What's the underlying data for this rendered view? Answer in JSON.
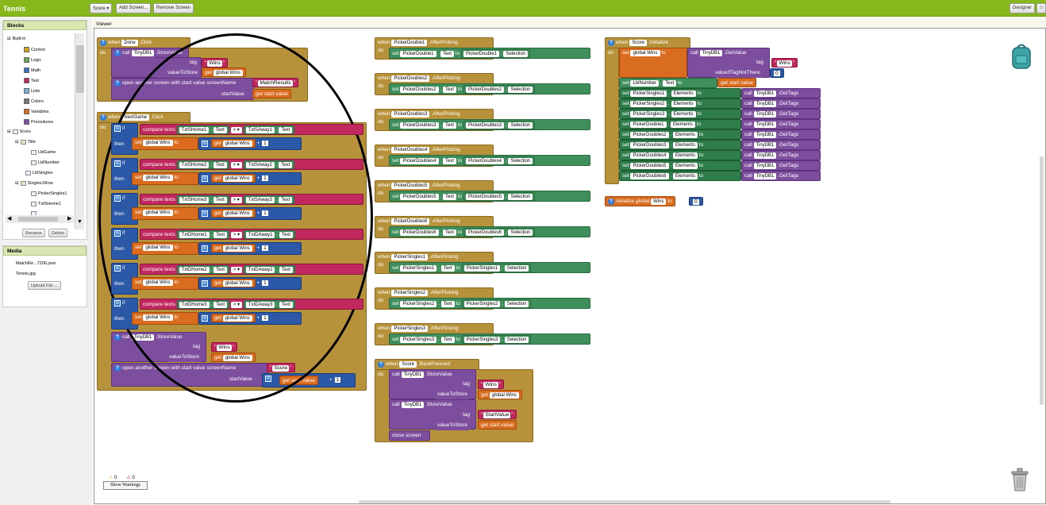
{
  "app": {
    "project_title": "Tennis",
    "screen_selector": "Score ▾",
    "add_screen": "Add Screen...",
    "remove_screen": "Remove Screen",
    "designer": "Designer",
    "blocks": "Bl"
  },
  "sidebar": {
    "blocks_title": "Blocks",
    "builtin": "Built-in",
    "builtin_items": [
      {
        "label": "Control",
        "color": "#d8a51e"
      },
      {
        "label": "Logic",
        "color": "#6aa84f"
      },
      {
        "label": "Math",
        "color": "#3d73c4"
      },
      {
        "label": "Text",
        "color": "#c0285e"
      },
      {
        "label": "Lists",
        "color": "#72b1d4"
      },
      {
        "label": "Colors",
        "color": "#777777"
      },
      {
        "label": "Variables",
        "color": "#d96c1e"
      },
      {
        "label": "Procedures",
        "color": "#7e4e9e"
      }
    ],
    "score": "Score",
    "title": "Title",
    "lbl_game": "LblGame",
    "lbl_number": "LblNumber",
    "lbl_singles": "LblSingles",
    "singles1_row": "Singles1Row",
    "picker_singles1": "PickerSingles1",
    "txt_shome1": "TxtSHome1",
    "rename": "Rename",
    "delete": "Delete",
    "media_title": "Media",
    "media_files": [
      "MatchRe...7206.json",
      "Tennis.jpg"
    ],
    "upload": "Upload File ..."
  },
  "viewer": {
    "title": "Viewer",
    "warnings": "0",
    "errors": "0",
    "show_warnings": "Show Warnings"
  },
  "kw": {
    "when": "when",
    "do": "do",
    "call": "call",
    "set": "set",
    "get": "get",
    "to": "to",
    "if": "if",
    "then": "then",
    "tag": "tag",
    "value_to_store": "valueToStore",
    "store_value": ".StoreValue",
    "click": ".Click",
    "after_picking": ".AfterPicking",
    "text": "Text",
    "selection": "Selection",
    "compare_texts": "compare texts",
    "gt": "> ▾",
    "plus": "+",
    "one": "1",
    "zero": "0",
    "open_another": "open another screen with start value",
    "screen_name": "screenName",
    "start_value": "startValue",
    "get_start_value": "get start value",
    "elements": "Elements",
    "get_tags": ".GetTags",
    "get_value": ".GetValue",
    "value_if_tag_not_there": "valueIfTagNotThere",
    "initialize": ".Initialize",
    "back_pressed": ".BackPressed",
    "close_screen": "close screen",
    "init_global": "initialize global",
    "wins": "Wins",
    "global_wins": "global Wins",
    "tinydb1": "TinyDB1",
    "match_results": "MatchResults",
    "score": "Score",
    "start_value_str": "StartValue",
    "done": "Done",
    "next_game": "NextGame",
    "lbl_number": "LblNumber"
  },
  "pickers": [
    {
      "picker": "PickerDouble1",
      "label": "PickerDouble1"
    },
    {
      "picker": "PickerDoubles2",
      "label": "PickerDoubles2"
    },
    {
      "picker": "PickerDoubles3",
      "label": "PickerDoubles3"
    },
    {
      "picker": "PickerDoubles4",
      "label": "PickerDoubles4"
    },
    {
      "picker": "PickerDoubles5",
      "label": "PickerDoubles5"
    },
    {
      "picker": "PickerDoubles6",
      "label": "PickerDoubles6"
    },
    {
      "picker": "PickerSingles1",
      "label": "PickerSingles1"
    },
    {
      "picker": "PickerSingles2",
      "label": "PickerSingles2"
    },
    {
      "picker": "PickerSingles3",
      "label": "PickerSingles3"
    }
  ],
  "compares": [
    {
      "home": "TxtSHome1",
      "away": "TxtSAway1"
    },
    {
      "home": "TxtSHome2",
      "away": "TxtSAway2"
    },
    {
      "home": "TxtSHome3",
      "away": "TxtSAway3"
    },
    {
      "home": "TxtDHome1",
      "away": "TxtDAway1"
    },
    {
      "home": "TxtDHome2",
      "away": "TxtDAway2"
    },
    {
      "home": "TxtDHome3",
      "away": "TxtDAway3"
    }
  ],
  "init_rows": [
    "PickerSingles1",
    "PickerSingles2",
    "PickerSingles3",
    "PickerDouble1",
    "PickerDoubles2",
    "PickerDoubles3",
    "PickerDoubles4",
    "PickerDoubles5",
    "PickerDoubles6"
  ]
}
